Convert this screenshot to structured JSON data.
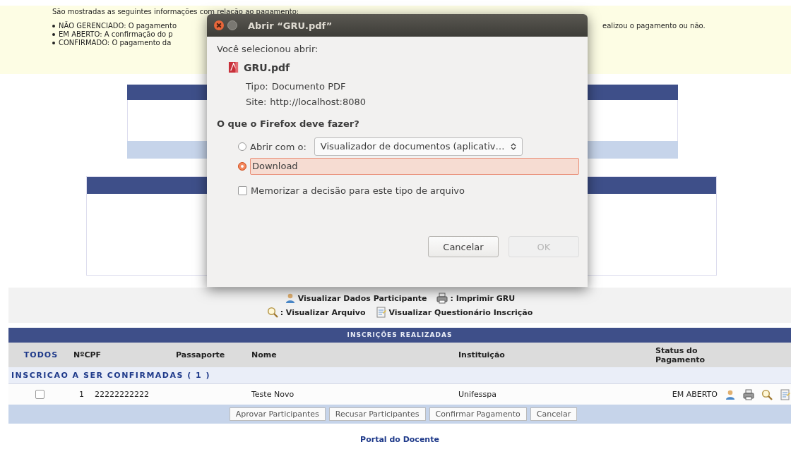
{
  "info": {
    "heading": "São mostradas as seguintes informações com relação ao pagamento:",
    "bullets": [
      {
        "left": "NÃO GERENCIADO: O pagamento",
        "right": "ealizou o pagamento ou não."
      },
      {
        "left": "EM ABERTO: A confirmação do p"
      },
      {
        "left": "CONFIRMADO: O pagamento da"
      }
    ]
  },
  "legend": [
    {
      "label": "Visualizar Dados Participante"
    },
    {
      "label": ": Imprimir GRU"
    },
    {
      "label": ": Visualizar Arquivo"
    },
    {
      "label": "Visualizar Questionário Inscrição"
    }
  ],
  "table": {
    "title": "INSCRIÇÕES REALIZADAS",
    "columns": [
      "TODOS",
      "NºCPF",
      "Passaporte",
      "Nome",
      "Instituição",
      "Status do Pagamento"
    ],
    "groups": [
      {
        "label": "INSCRICAO A SER CONFIRMADAS ( 1 )",
        "rows": [
          {
            "checked": false,
            "number": "1",
            "cpf": "22222222222",
            "nome": "Teste Novo",
            "instituicao": "Unifesspa",
            "status": "EM ABERTO"
          }
        ]
      }
    ],
    "buttons": [
      "Aprovar Participantes",
      "Recusar Participantes",
      "Confirmar Pagamento",
      "Cancelar"
    ]
  },
  "footer_link": "Portal do Docente",
  "dialog": {
    "title": "Abrir “GRU.pdf”",
    "intro": "Você selecionou abrir:",
    "file": "GRU.pdf",
    "details": [
      {
        "label": "Tipo:",
        "value": "Documento PDF"
      },
      {
        "label": "Site:",
        "value": "http://localhost:8080"
      }
    ],
    "question": "O que o Firefox deve fazer?",
    "options": [
      {
        "kind": "open_with",
        "label": "Abrir com o:",
        "selected": false,
        "app": "Visualizador de documentos (aplicativ…"
      },
      {
        "kind": "download",
        "label": "Download",
        "selected": true
      }
    ],
    "remember": {
      "label": "Memorizar a decisão para este tipo de arquivo",
      "checked": false
    },
    "buttons": [
      {
        "label": "Cancelar",
        "disabled": false
      },
      {
        "label": "OK",
        "disabled": true
      }
    ]
  }
}
